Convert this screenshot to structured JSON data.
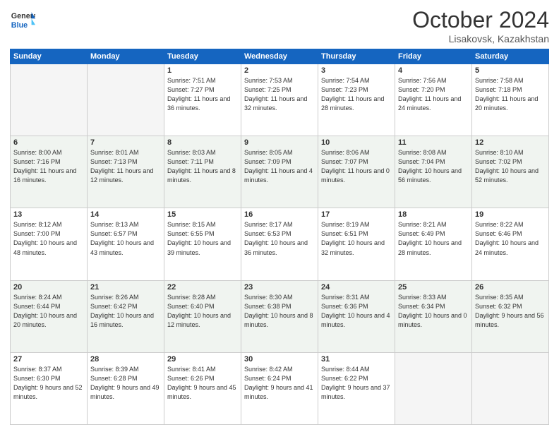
{
  "header": {
    "logo_general": "General",
    "logo_blue": "Blue",
    "month": "October 2024",
    "location": "Lisakovsk, Kazakhstan"
  },
  "weekdays": [
    "Sunday",
    "Monday",
    "Tuesday",
    "Wednesday",
    "Thursday",
    "Friday",
    "Saturday"
  ],
  "weeks": [
    [
      {
        "day": "",
        "empty": true
      },
      {
        "day": "",
        "empty": true
      },
      {
        "day": "1",
        "sunrise": "Sunrise: 7:51 AM",
        "sunset": "Sunset: 7:27 PM",
        "daylight": "Daylight: 11 hours and 36 minutes."
      },
      {
        "day": "2",
        "sunrise": "Sunrise: 7:53 AM",
        "sunset": "Sunset: 7:25 PM",
        "daylight": "Daylight: 11 hours and 32 minutes."
      },
      {
        "day": "3",
        "sunrise": "Sunrise: 7:54 AM",
        "sunset": "Sunset: 7:23 PM",
        "daylight": "Daylight: 11 hours and 28 minutes."
      },
      {
        "day": "4",
        "sunrise": "Sunrise: 7:56 AM",
        "sunset": "Sunset: 7:20 PM",
        "daylight": "Daylight: 11 hours and 24 minutes."
      },
      {
        "day": "5",
        "sunrise": "Sunrise: 7:58 AM",
        "sunset": "Sunset: 7:18 PM",
        "daylight": "Daylight: 11 hours and 20 minutes."
      }
    ],
    [
      {
        "day": "6",
        "sunrise": "Sunrise: 8:00 AM",
        "sunset": "Sunset: 7:16 PM",
        "daylight": "Daylight: 11 hours and 16 minutes."
      },
      {
        "day": "7",
        "sunrise": "Sunrise: 8:01 AM",
        "sunset": "Sunset: 7:13 PM",
        "daylight": "Daylight: 11 hours and 12 minutes."
      },
      {
        "day": "8",
        "sunrise": "Sunrise: 8:03 AM",
        "sunset": "Sunset: 7:11 PM",
        "daylight": "Daylight: 11 hours and 8 minutes."
      },
      {
        "day": "9",
        "sunrise": "Sunrise: 8:05 AM",
        "sunset": "Sunset: 7:09 PM",
        "daylight": "Daylight: 11 hours and 4 minutes."
      },
      {
        "day": "10",
        "sunrise": "Sunrise: 8:06 AM",
        "sunset": "Sunset: 7:07 PM",
        "daylight": "Daylight: 11 hours and 0 minutes."
      },
      {
        "day": "11",
        "sunrise": "Sunrise: 8:08 AM",
        "sunset": "Sunset: 7:04 PM",
        "daylight": "Daylight: 10 hours and 56 minutes."
      },
      {
        "day": "12",
        "sunrise": "Sunrise: 8:10 AM",
        "sunset": "Sunset: 7:02 PM",
        "daylight": "Daylight: 10 hours and 52 minutes."
      }
    ],
    [
      {
        "day": "13",
        "sunrise": "Sunrise: 8:12 AM",
        "sunset": "Sunset: 7:00 PM",
        "daylight": "Daylight: 10 hours and 48 minutes."
      },
      {
        "day": "14",
        "sunrise": "Sunrise: 8:13 AM",
        "sunset": "Sunset: 6:57 PM",
        "daylight": "Daylight: 10 hours and 43 minutes."
      },
      {
        "day": "15",
        "sunrise": "Sunrise: 8:15 AM",
        "sunset": "Sunset: 6:55 PM",
        "daylight": "Daylight: 10 hours and 39 minutes."
      },
      {
        "day": "16",
        "sunrise": "Sunrise: 8:17 AM",
        "sunset": "Sunset: 6:53 PM",
        "daylight": "Daylight: 10 hours and 36 minutes."
      },
      {
        "day": "17",
        "sunrise": "Sunrise: 8:19 AM",
        "sunset": "Sunset: 6:51 PM",
        "daylight": "Daylight: 10 hours and 32 minutes."
      },
      {
        "day": "18",
        "sunrise": "Sunrise: 8:21 AM",
        "sunset": "Sunset: 6:49 PM",
        "daylight": "Daylight: 10 hours and 28 minutes."
      },
      {
        "day": "19",
        "sunrise": "Sunrise: 8:22 AM",
        "sunset": "Sunset: 6:46 PM",
        "daylight": "Daylight: 10 hours and 24 minutes."
      }
    ],
    [
      {
        "day": "20",
        "sunrise": "Sunrise: 8:24 AM",
        "sunset": "Sunset: 6:44 PM",
        "daylight": "Daylight: 10 hours and 20 minutes."
      },
      {
        "day": "21",
        "sunrise": "Sunrise: 8:26 AM",
        "sunset": "Sunset: 6:42 PM",
        "daylight": "Daylight: 10 hours and 16 minutes."
      },
      {
        "day": "22",
        "sunrise": "Sunrise: 8:28 AM",
        "sunset": "Sunset: 6:40 PM",
        "daylight": "Daylight: 10 hours and 12 minutes."
      },
      {
        "day": "23",
        "sunrise": "Sunrise: 8:30 AM",
        "sunset": "Sunset: 6:38 PM",
        "daylight": "Daylight: 10 hours and 8 minutes."
      },
      {
        "day": "24",
        "sunrise": "Sunrise: 8:31 AM",
        "sunset": "Sunset: 6:36 PM",
        "daylight": "Daylight: 10 hours and 4 minutes."
      },
      {
        "day": "25",
        "sunrise": "Sunrise: 8:33 AM",
        "sunset": "Sunset: 6:34 PM",
        "daylight": "Daylight: 10 hours and 0 minutes."
      },
      {
        "day": "26",
        "sunrise": "Sunrise: 8:35 AM",
        "sunset": "Sunset: 6:32 PM",
        "daylight": "Daylight: 9 hours and 56 minutes."
      }
    ],
    [
      {
        "day": "27",
        "sunrise": "Sunrise: 8:37 AM",
        "sunset": "Sunset: 6:30 PM",
        "daylight": "Daylight: 9 hours and 52 minutes."
      },
      {
        "day": "28",
        "sunrise": "Sunrise: 8:39 AM",
        "sunset": "Sunset: 6:28 PM",
        "daylight": "Daylight: 9 hours and 49 minutes."
      },
      {
        "day": "29",
        "sunrise": "Sunrise: 8:41 AM",
        "sunset": "Sunset: 6:26 PM",
        "daylight": "Daylight: 9 hours and 45 minutes."
      },
      {
        "day": "30",
        "sunrise": "Sunrise: 8:42 AM",
        "sunset": "Sunset: 6:24 PM",
        "daylight": "Daylight: 9 hours and 41 minutes."
      },
      {
        "day": "31",
        "sunrise": "Sunrise: 8:44 AM",
        "sunset": "Sunset: 6:22 PM",
        "daylight": "Daylight: 9 hours and 37 minutes."
      },
      {
        "day": "",
        "empty": true
      },
      {
        "day": "",
        "empty": true
      }
    ]
  ]
}
